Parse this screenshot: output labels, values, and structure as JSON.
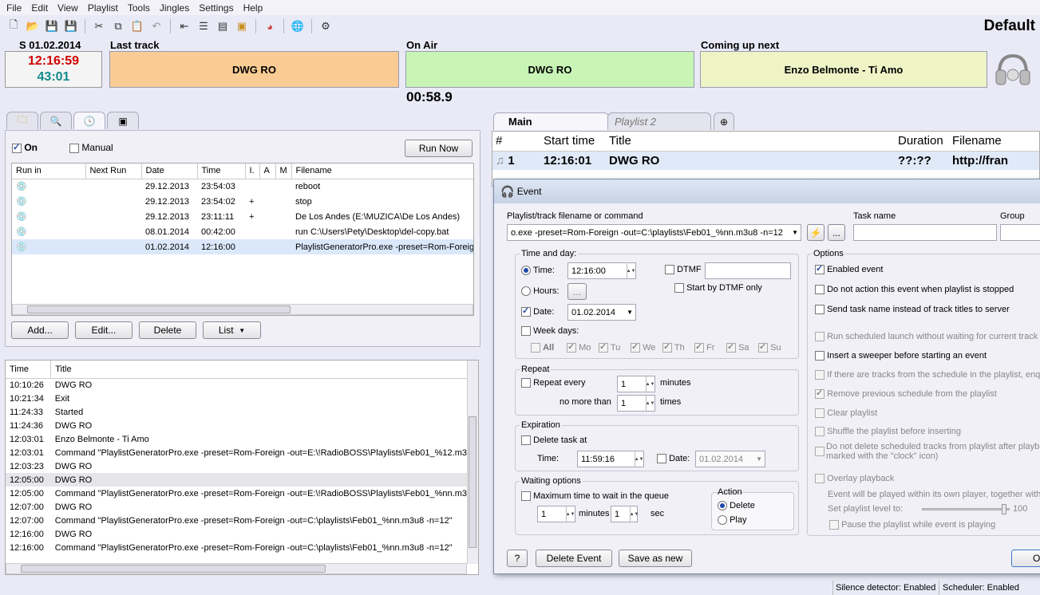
{
  "menu": [
    "File",
    "Edit",
    "View",
    "Playlist",
    "Tools",
    "Jingles",
    "Settings",
    "Help"
  ],
  "toolbar_icons": [
    "new-icon",
    "open-icon",
    "save-icon",
    "save-as-icon",
    "undo-icon",
    "cut-icon",
    "copy-icon",
    "paste-icon",
    "redo-icon",
    "insert-icon",
    "playlist-icon",
    "generator-icon",
    "folder-icon",
    "pie-chart-icon",
    "globe-icon",
    "settings-gear-icon"
  ],
  "profile": "Default",
  "date_label": "S 01.02.2014",
  "clock": {
    "time": "12:16:59",
    "remaining": "43:01"
  },
  "last_track": {
    "label": "Last track",
    "value": "DWG RO",
    "color": "#f9cc95"
  },
  "on_air": {
    "label": "On Air",
    "value": "DWG RO",
    "timer": "00:58.9",
    "color": "#c8f5b6"
  },
  "coming_up": {
    "label": "Coming up next",
    "value": "Enzo Belmonte - Ti Amo",
    "color": "#eef4c6"
  },
  "scheduler": {
    "on_label": "On",
    "manual_label": "Manual",
    "run_now": "Run Now",
    "columns": [
      "Run in",
      "Next Run",
      "Date",
      "Time",
      "I.",
      "A",
      "M",
      "Filename"
    ],
    "rows": [
      {
        "date": "29.12.2013",
        "time": "23:54:03",
        "i": "",
        "filename": "reboot"
      },
      {
        "date": "29.12.2013",
        "time": "23:54:02",
        "i": "+",
        "filename": "stop"
      },
      {
        "date": "29.12.2013",
        "time": "23:11:11",
        "i": "+",
        "filename": "De Los Andes  (E:\\MUZICA\\De Los Andes)"
      },
      {
        "date": "08.01.2014",
        "time": "00:42:00",
        "i": "",
        "filename": "run C:\\Users\\Pety\\Desktop\\del-copy.bat"
      },
      {
        "date": "01.02.2014",
        "time": "12:16:00",
        "i": "",
        "filename": "PlaylistGeneratorPro.exe -preset=Rom-Foreign"
      }
    ],
    "buttons": {
      "add": "Add...",
      "edit": "Edit...",
      "delete": "Delete",
      "list": "List"
    }
  },
  "log": {
    "columns": [
      "Time",
      "Title"
    ],
    "rows": [
      [
        "10:10:26",
        "DWG RO"
      ],
      [
        "10:21:34",
        "Exit"
      ],
      [
        "11:24:33",
        "Started"
      ],
      [
        "11:24:36",
        "DWG RO"
      ],
      [
        "12:03:01",
        "Enzo Belmonte - Ti Amo"
      ],
      [
        "12:03:01",
        "Command \"PlaylistGeneratorPro.exe -preset=Rom-Foreign -out=E:\\!RadioBOSS\\Playlists\\Feb01_%12.m3"
      ],
      [
        "12:03:23",
        "DWG RO"
      ],
      [
        "12:05:00",
        "DWG RO"
      ],
      [
        "12:05:00",
        "Command \"PlaylistGeneratorPro.exe -preset=Rom-Foreign -out=E:\\!RadioBOSS\\Playlists\\Feb01_%nn.m3"
      ],
      [
        "12:07:00",
        "DWG RO"
      ],
      [
        "12:07:00",
        "Command \"PlaylistGeneratorPro.exe -preset=Rom-Foreign -out=C:\\playlists\\Feb01_%nn.m3u8 -n=12\""
      ],
      [
        "12:16:00",
        "DWG RO"
      ],
      [
        "12:16:00",
        "Command \"PlaylistGeneratorPro.exe -preset=Rom-Foreign -out=C:\\playlists\\Feb01_%nn.m3u8 -n=12\""
      ]
    ]
  },
  "playlist": {
    "tabs": [
      "Main",
      "Playlist 2"
    ],
    "columns": [
      "#",
      "Start time",
      "Title",
      "Duration",
      "Filename"
    ],
    "rows": [
      {
        "num": "1",
        "start": "12:16:01",
        "title": "DWG RO",
        "duration": "??:??",
        "filename": "http://fran"
      }
    ]
  },
  "event": {
    "title": "Event",
    "cmd_label": "Playlist/track filename or command",
    "cmd_value": "o.exe -preset=Rom-Foreign -out=C:\\playlists\\Feb01_%nn.m3u8 -n=12",
    "task_name_label": "Task name",
    "group_label": "Group",
    "browse": "...",
    "time_and_day": "Time and day:",
    "time_label": "Time:",
    "time_value": "12:16:00",
    "hours_label": "Hours:",
    "hours_btn": "...",
    "date_label": "Date:",
    "date_value": "01.02.2014",
    "week_days_label": "Week days:",
    "weekdays": [
      "All",
      "Mo",
      "Tu",
      "We",
      "Th",
      "Fr",
      "Sa",
      "Su"
    ],
    "dtmf_label": "DTMF",
    "start_by_dtmf": "Start by DTMF only",
    "repeat": "Repeat",
    "repeat_every": "Repeat every",
    "repeat_every_value": "1",
    "minutes": "minutes",
    "no_more_than": "no more than",
    "no_more_than_value": "1",
    "times": "times",
    "expiration": "Expiration",
    "delete_task_at": "Delete task at",
    "exp_time_label": "Time:",
    "exp_time_value": "11:59:16",
    "exp_date_label": "Date:",
    "exp_date_value": "01.02.2014",
    "waiting": "Waiting options",
    "max_time": "Maximum time to wait in the queue",
    "wait_min_value": "1",
    "wait_minutes": "minutes",
    "wait_sec_value": "1",
    "sec": "sec",
    "action": "Action",
    "action_delete": "Delete",
    "action_play": "Play",
    "options_label": "Options",
    "options": [
      {
        "label": "Enabled event",
        "checked": true,
        "enabled": true
      },
      {
        "label": "Do not action this event when playlist is stopped",
        "checked": false,
        "enabled": true
      },
      {
        "label": "Send task name instead of track titles to server",
        "checked": false,
        "enabled": true
      },
      {
        "label": "Run scheduled launch without waiting for current track t",
        "checked": false,
        "enabled": false
      },
      {
        "label": "Insert a sweeper before starting an event",
        "checked": false,
        "enabled": true
      },
      {
        "label": "If there are tracks from the schedule in the playlist, enq",
        "checked": false,
        "enabled": false
      },
      {
        "label": "Remove previous schedule from the playlist",
        "checked": true,
        "enabled": false
      },
      {
        "label": "Clear playlist",
        "checked": false,
        "enabled": false
      },
      {
        "label": "Shuffle the playlist before inserting",
        "checked": false,
        "enabled": false
      }
    ],
    "do_not_delete_1": "Do not delete scheduled tracks from playlist after playba",
    "do_not_delete_2": "marked with the \"clock\" icon)",
    "overlay": "Overlay playback",
    "overlay_note": "Event will be played within its own player, together with",
    "set_level": "Set playlist level to:",
    "level_value": "100",
    "level_fraction": 0.95,
    "pause_playlist": "Pause the playlist while event is playing",
    "help_btn": "?",
    "delete_event": "Delete Event",
    "save_as_new": "Save as new",
    "ok_partial": "O"
  },
  "status": {
    "silence": "Silence detector: Enabled",
    "scheduler": "Scheduler: Enabled"
  }
}
